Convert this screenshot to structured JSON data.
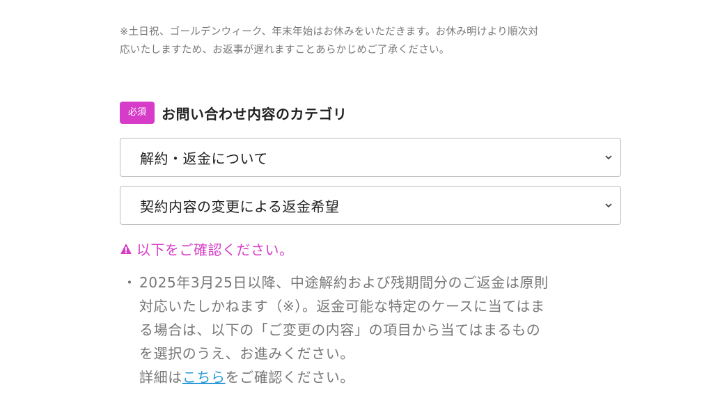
{
  "notice": {
    "line1": "※土日祝、ゴールデンウィーク、年末年始はお休みをいただきます。お休み明けより順次対",
    "line2": "応いたしますため、お返事が遅れますことあらかじめご了承ください。"
  },
  "category": {
    "required_badge": "必須",
    "title": "お問い合わせ内容のカテゴリ"
  },
  "selects": {
    "primary_value": "解約・返金について",
    "secondary_value": "契約内容の変更による返金希望"
  },
  "warning": {
    "text": "以下をご確認ください。",
    "color": "#d63cc8"
  },
  "bullet": {
    "dot": "・",
    "line1": "2025年3月25日以降、中途解約および残期間分のご返金は原則",
    "line2": "対応いたしかねます（※）。返金可能な特定のケースに当てはま",
    "line3": "る場合は、以下の「ご変更の内容」の項目から当てはまるもの",
    "line4": "を選択のうえ、お進みください。",
    "line5_prefix": "詳細は",
    "line5_link": "こちら",
    "line5_suffix": "をご確認ください。"
  }
}
